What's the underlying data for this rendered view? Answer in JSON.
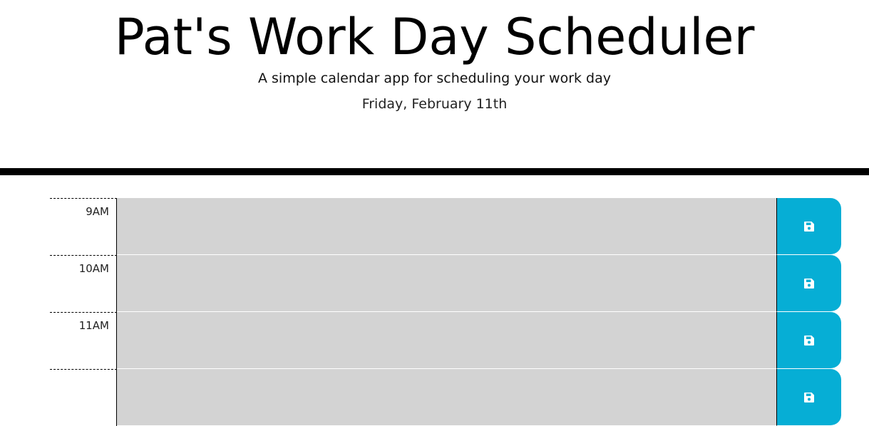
{
  "header": {
    "title": "Pat's Work Day Scheduler",
    "subtitle": "A simple calendar app for scheduling your work day",
    "date": "Friday, February 11th"
  },
  "time_blocks": [
    {
      "hour": "9AM",
      "text": "",
      "save_icon": "save-icon"
    },
    {
      "hour": "10AM",
      "text": "",
      "save_icon": "save-icon"
    },
    {
      "hour": "11AM",
      "text": "",
      "save_icon": "save-icon"
    },
    {
      "hour": "",
      "text": "",
      "save_icon": "save-icon"
    }
  ],
  "colors": {
    "past": "#d3d3d3",
    "save_button": "#06aed5",
    "header_border": "#000000"
  }
}
